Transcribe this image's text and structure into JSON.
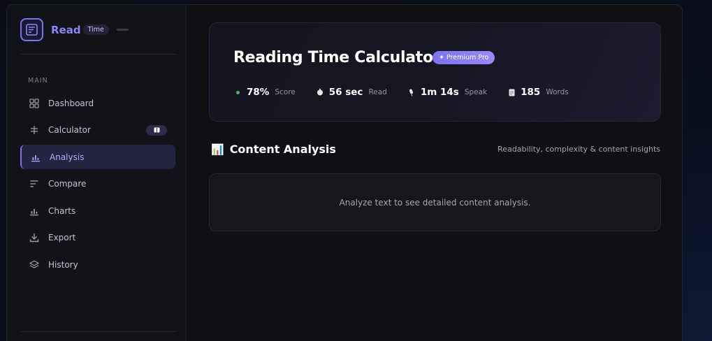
{
  "brand": {
    "name": "Read",
    "badge": "Time",
    "logo_icon": "document-icon"
  },
  "sidebar": {
    "section_label": "MAIN",
    "items": [
      {
        "label": "Dashboard",
        "icon": "grid-icon",
        "active": false
      },
      {
        "label": "Calculator",
        "icon": "sliders-icon",
        "active": false,
        "badge": "📖"
      },
      {
        "label": "Analysis",
        "icon": "bar-chart-icon",
        "active": true
      },
      {
        "label": "Compare",
        "icon": "list-icon",
        "active": false
      },
      {
        "label": "Charts",
        "icon": "bar-chart-icon",
        "active": false
      },
      {
        "label": "Export",
        "icon": "download-icon",
        "active": false
      },
      {
        "label": "History",
        "icon": "layers-icon",
        "active": false
      }
    ]
  },
  "hero": {
    "title": "Reading Time Calculator",
    "badge": "✦ Premium Pro",
    "stats": [
      {
        "value": "78%",
        "label": "Score",
        "icon": "status-dot-icon"
      },
      {
        "value": "56 sec",
        "label": "Read",
        "icon": "timer-icon"
      },
      {
        "value": "1m 14s",
        "label": "Speak",
        "icon": "microphone-icon"
      },
      {
        "value": "185",
        "label": "Words",
        "icon": "document-icon"
      }
    ]
  },
  "content": {
    "title_icon": "📊",
    "title": "Content Analysis",
    "subtitle": "Readability, complexity & content insights",
    "empty_message": "Analyze text to see detailed content analysis."
  },
  "colors": {
    "accent": "#7b74f0",
    "score_dot": "#3fb46a",
    "background": "#0f0f14"
  }
}
